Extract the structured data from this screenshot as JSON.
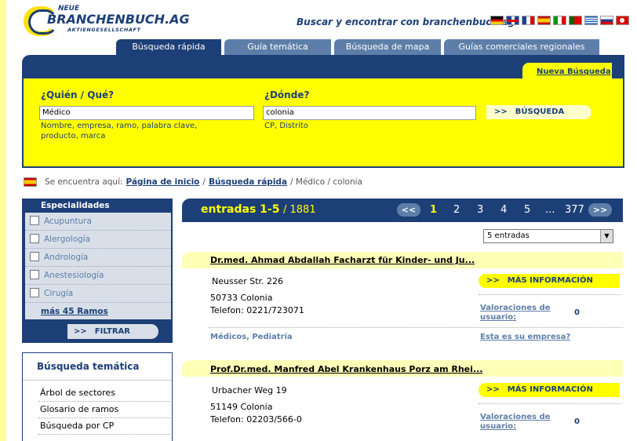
{
  "header": {
    "logo_neue": "NEUE",
    "logo_name": "BRANCHENBUCH.AG",
    "logo_sub": "AKTIENGESELLSCHAFT",
    "tagline": "Buscar y encontrar con branchenbuch.ag"
  },
  "tabs": [
    {
      "label": "Búsqueda rápida",
      "active": true
    },
    {
      "label": "Guía temática",
      "active": false
    },
    {
      "label": "Búsqueda de mapa",
      "active": false
    },
    {
      "label": "Guías comerciales regionales",
      "active": false
    }
  ],
  "search": {
    "new_search": "Nueva Búsqueda",
    "who_label": "¿Quién / Qué?",
    "who_value": "Médico",
    "who_hint1": "Nombre, empresa, ramo, palabra clave,",
    "who_hint2": "producto, marca",
    "where_label": "¿Dónde?",
    "where_value": "colonia",
    "where_hint": "CP, Distrito",
    "button": "BÚSQUEDA"
  },
  "breadcrumb": {
    "prefix": "Se encuentra aquí:",
    "home": "Página de inicio",
    "quick": "Búsqueda rápida",
    "rest": "/ Médico / colonia"
  },
  "specialties": {
    "title": "Especialidades",
    "items": [
      "Acupuntura",
      "Alergología",
      "Andrología",
      "Anestesiología",
      "Cirugía"
    ],
    "more": "más 45 Ramos",
    "filter": "FILTRAR"
  },
  "thematic": {
    "title": "Búsqueda temática",
    "items": [
      "Árbol de sectores",
      "Glosario de ramos",
      "Búsqueda por CP"
    ]
  },
  "results": {
    "entries": "entradas 1-5",
    "total": "/ 1881",
    "prev": "<<",
    "next": ">>",
    "pages": [
      "1",
      "2",
      "3",
      "4",
      "5",
      "...",
      "377"
    ],
    "per_page": "5 entradas",
    "items": [
      {
        "title": "Dr.med. Ahmad Abdallah Facharzt für Kinder- und Ju...",
        "street": "Neusser Str. 226",
        "city": "50733 Colonia",
        "phone": "Telefon: 0221/723071",
        "more_info": "MÁS INFORMACIÓN",
        "ratings_line1": "Valoraciones de",
        "ratings_line2": "usuario:",
        "ratings": "0",
        "categories": "Médicos, Pediatría",
        "company": "Esta es su empresa?"
      },
      {
        "title": "Prof.Dr.med. Manfred Abel Krankenhaus Porz am Rhei...",
        "street": "Urbacher Weg 19",
        "city": "51149 Colonia",
        "phone": "Telefon: 02203/566-0",
        "more_info": "MÁS INFORMACIÓN",
        "ratings_line1": "Valoraciones de",
        "ratings_line2": "usuario:",
        "ratings": "0"
      }
    ]
  }
}
